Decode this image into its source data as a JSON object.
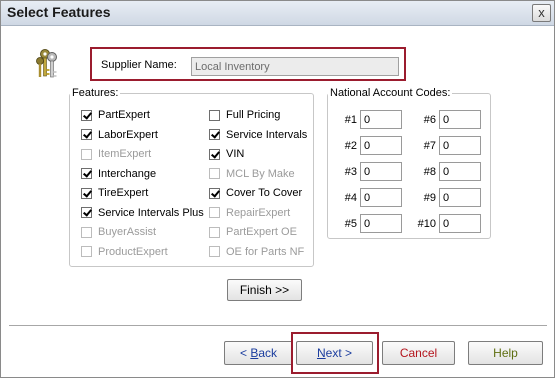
{
  "window": {
    "title": "Select Features",
    "close_glyph": "x"
  },
  "supplier": {
    "label": "Supplier Name:",
    "value": "Local Inventory",
    "icon": "keys-icon"
  },
  "features": {
    "legend": "Features:",
    "left": [
      {
        "label": "PartExpert",
        "checked": true,
        "enabled": true
      },
      {
        "label": "LaborExpert",
        "checked": true,
        "enabled": true
      },
      {
        "label": "ItemExpert",
        "checked": false,
        "enabled": false
      },
      {
        "label": "Interchange",
        "checked": true,
        "enabled": true
      },
      {
        "label": "TireExpert",
        "checked": true,
        "enabled": true
      },
      {
        "label": "Service Intervals Plus",
        "checked": true,
        "enabled": true
      },
      {
        "label": "BuyerAssist",
        "checked": false,
        "enabled": false
      },
      {
        "label": "ProductExpert",
        "checked": false,
        "enabled": false
      }
    ],
    "right": [
      {
        "label": "Full Pricing",
        "checked": false,
        "enabled": true
      },
      {
        "label": "Service Intervals",
        "checked": true,
        "enabled": true
      },
      {
        "label": "VIN",
        "checked": true,
        "enabled": true
      },
      {
        "label": "MCL By Make",
        "checked": false,
        "enabled": false
      },
      {
        "label": "Cover To Cover",
        "checked": true,
        "enabled": true
      },
      {
        "label": "RepairExpert",
        "checked": false,
        "enabled": false
      },
      {
        "label": "PartExpert OE",
        "checked": false,
        "enabled": false
      },
      {
        "label": "OE for Parts NF",
        "checked": false,
        "enabled": false
      }
    ]
  },
  "accounts": {
    "legend": "National Account Codes:",
    "codes": [
      {
        "label": "#1",
        "value": "0"
      },
      {
        "label": "#2",
        "value": "0"
      },
      {
        "label": "#3",
        "value": "0"
      },
      {
        "label": "#4",
        "value": "0"
      },
      {
        "label": "#5",
        "value": "0"
      },
      {
        "label": "#6",
        "value": "0"
      },
      {
        "label": "#7",
        "value": "0"
      },
      {
        "label": "#8",
        "value": "0"
      },
      {
        "label": "#9",
        "value": "0"
      },
      {
        "label": "#10",
        "value": "0"
      }
    ]
  },
  "buttons": {
    "finish": "Finish >>",
    "back_mnemonic": "B",
    "back_rest": "ack",
    "back_prefix": "< ",
    "next_mnemonic": "N",
    "next_rest": "ext >",
    "cancel": "Cancel",
    "help": "Help"
  },
  "colors": {
    "highlight": "#9b1c2e",
    "nav_text": "#1a3c9e",
    "cancel_text": "#b4151d",
    "help_text": "#5e6e10"
  }
}
